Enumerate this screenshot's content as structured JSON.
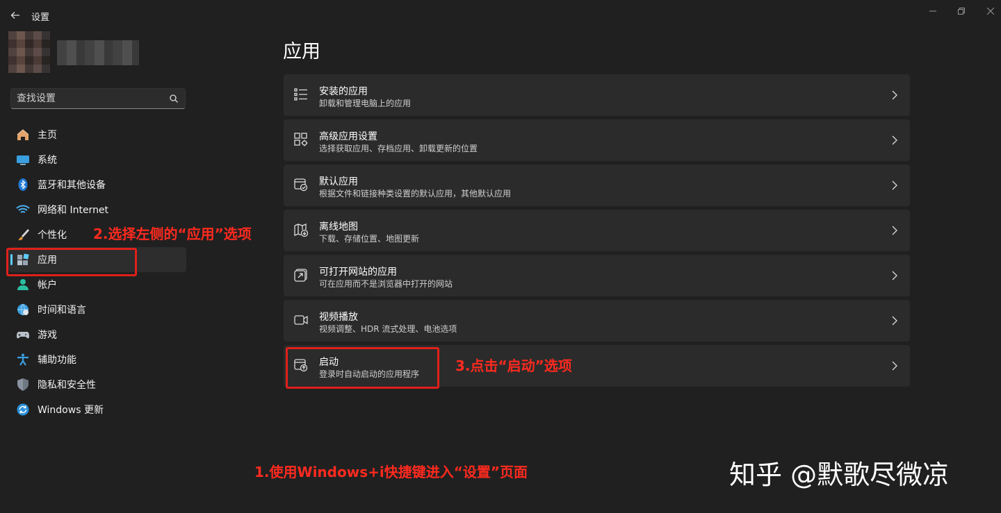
{
  "window": {
    "title": "设置",
    "back_icon": "arrow-left-icon",
    "controls": [
      "minimize-icon",
      "maximize-icon",
      "close-icon"
    ]
  },
  "search": {
    "placeholder": "查找设置",
    "icon": "search-icon"
  },
  "sidebar": {
    "items": [
      {
        "label": "主页",
        "icon": "home-icon",
        "active": false
      },
      {
        "label": "系统",
        "icon": "monitor-icon",
        "active": false
      },
      {
        "label": "蓝牙和其他设备",
        "icon": "bluetooth-icon",
        "active": false
      },
      {
        "label": "网络和 Internet",
        "icon": "wifi-icon",
        "active": false
      },
      {
        "label": "个性化",
        "icon": "brush-icon",
        "active": false
      },
      {
        "label": "应用",
        "icon": "apps-icon",
        "active": true
      },
      {
        "label": "帐户",
        "icon": "person-icon",
        "active": false
      },
      {
        "label": "时间和语言",
        "icon": "globe-clock-icon",
        "active": false
      },
      {
        "label": "游戏",
        "icon": "gamepad-icon",
        "active": false
      },
      {
        "label": "辅助功能",
        "icon": "accessibility-icon",
        "active": false
      },
      {
        "label": "隐私和安全性",
        "icon": "shield-icon",
        "active": false
      },
      {
        "label": "Windows 更新",
        "icon": "update-icon",
        "active": false
      }
    ]
  },
  "main": {
    "title": "应用",
    "cards": [
      {
        "title": "安装的应用",
        "subtitle": "卸载和管理电脑上的应用",
        "icon": "list-icon"
      },
      {
        "title": "高级应用设置",
        "subtitle": "选择获取应用、存档应用、卸载更新的位置",
        "icon": "app-settings-icon"
      },
      {
        "title": "默认应用",
        "subtitle": "根据文件和链接种类设置的默认应用，其他默认应用",
        "icon": "default-apps-icon"
      },
      {
        "title": "离线地图",
        "subtitle": "下载、存储位置、地图更新",
        "icon": "map-icon"
      },
      {
        "title": "可打开网站的应用",
        "subtitle": "可在应用而不是浏览器中打开的网站",
        "icon": "open-external-icon"
      },
      {
        "title": "视频播放",
        "subtitle": "视频调整、HDR 流式处理、电池选项",
        "icon": "video-icon"
      },
      {
        "title": "启动",
        "subtitle": "登录时自动启动的应用程序",
        "icon": "startup-icon"
      }
    ]
  },
  "annotations": {
    "step1": "1.使用Windows+i快捷键进入“设置”页面",
    "step2": "2.选择左侧的“应用”选项",
    "step3": "3.点击“启动”选项",
    "color": "#e0201a"
  },
  "watermark": "知乎 @默歌尽微凉",
  "colors": {
    "background": "#202020",
    "card": "#2b2b2b",
    "accent": "#60cdff"
  }
}
